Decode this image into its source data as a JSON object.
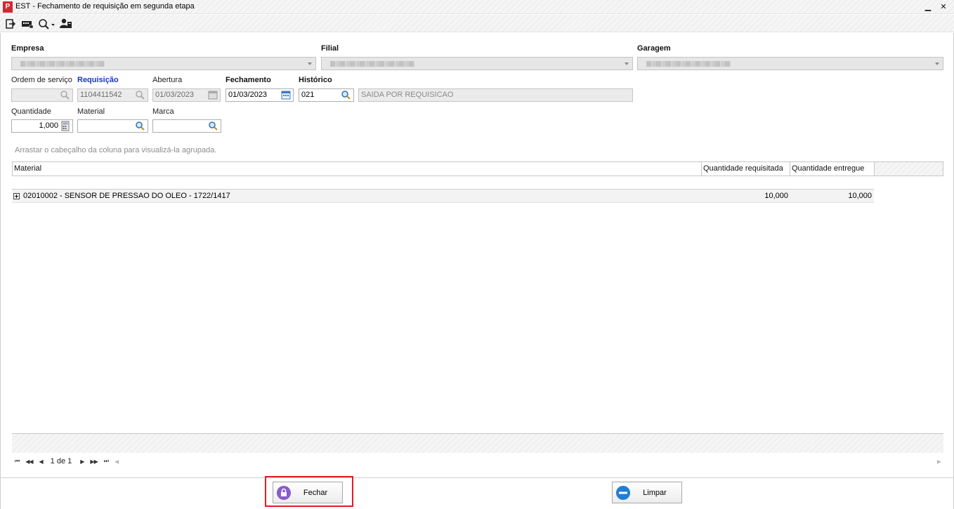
{
  "window": {
    "title": "EST - Fechamento de requisição em segunda etapa",
    "app_icon_letter": "P",
    "controls": {
      "minimize": "▁",
      "close": "✕"
    }
  },
  "toolbar": {
    "icons": [
      "exit-icon",
      "keyboard-icon",
      "search-dropdown-icon",
      "user-icon"
    ]
  },
  "form": {
    "empresa": {
      "label": "Empresa",
      "value": ""
    },
    "filial": {
      "label": "Filial",
      "value": ""
    },
    "garagem": {
      "label": "Garagem",
      "value": ""
    },
    "ordem_servico": {
      "label": "Ordem de serviço",
      "value": ""
    },
    "requisicao": {
      "label": "Requisição",
      "value": "1104411542"
    },
    "abertura": {
      "label": "Abertura",
      "value": "01/03/2023"
    },
    "fechamento": {
      "label": "Fechamento",
      "value": "01/03/2023"
    },
    "historico": {
      "label": "Histórico",
      "code": "021",
      "description": "SAIDA POR REQUISICAO"
    },
    "quantidade": {
      "label": "Quantidade",
      "value": "1,000"
    },
    "material": {
      "label": "Material",
      "value": ""
    },
    "marca": {
      "label": "Marca",
      "value": ""
    }
  },
  "grid": {
    "group_hint": "Arrastar o cabeçalho da coluna para visualizá-la agrupada.",
    "columns": [
      "Material",
      "Quantidade requisitada",
      "Quantidade entregue"
    ],
    "rows": [
      {
        "material": "02010002 - SENSOR DE PRESSAO DO OLEO - 1722/1417",
        "qtd_requisitada": "10,000",
        "qtd_entregue": "10,000"
      }
    ],
    "pager": {
      "text": "1 de 1"
    }
  },
  "buttons": {
    "fechar": "Fechar",
    "limpar": "Limpar"
  },
  "colors": {
    "required_label": "#1a33cc",
    "highlight_border": "#e01c24",
    "app_icon": "#d7262f"
  }
}
